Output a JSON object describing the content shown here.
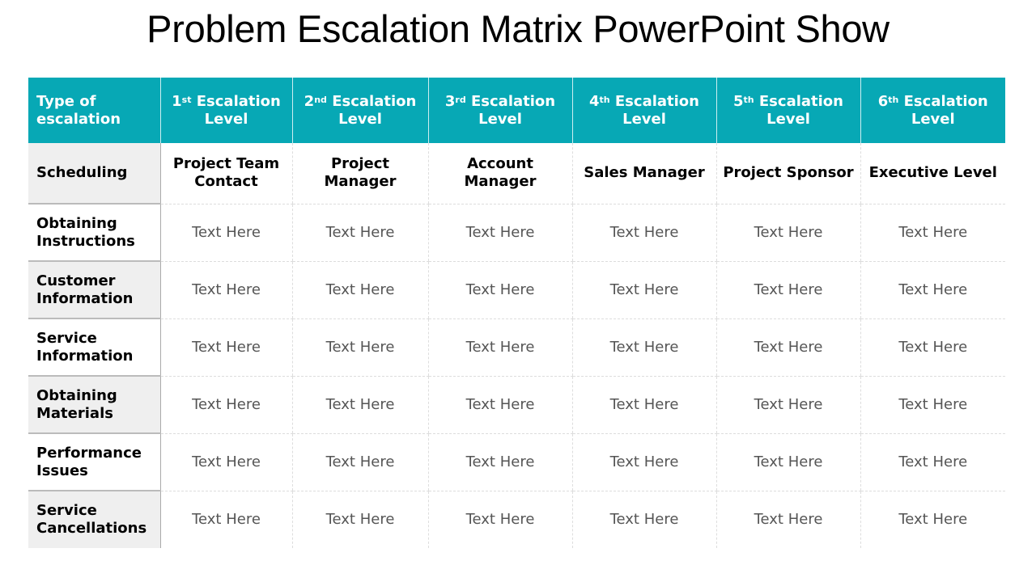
{
  "title": "Problem Escalation Matrix PowerPoint Show",
  "colors": {
    "header_bg": "#07a8b5",
    "header_text": "#ffffff",
    "rowhead_shade": "#efefef",
    "cell_text": "#555555"
  },
  "header": {
    "type_label": "Type of escalation",
    "levels": [
      {
        "num": "1",
        "suffix": "st",
        "label": "Escalation Level"
      },
      {
        "num": "2",
        "suffix": "nd",
        "label": "Escalation Level"
      },
      {
        "num": "3",
        "suffix": "rd",
        "label": "Escalation Level"
      },
      {
        "num": "4",
        "suffix": "th",
        "label": "Escalation Level"
      },
      {
        "num": "5",
        "suffix": "th",
        "label": "Escalation Level"
      },
      {
        "num": "6",
        "suffix": "th",
        "label": "Escalation Level"
      }
    ]
  },
  "rows": [
    {
      "type": "Scheduling",
      "cells": [
        "Project Team Contact",
        "Project Manager",
        "Account Manager",
        "Sales Manager",
        "Project Sponsor",
        "Executive Level"
      ]
    },
    {
      "type": "Obtaining Instructions",
      "cells": [
        "Text Here",
        "Text Here",
        "Text Here",
        "Text Here",
        "Text Here",
        "Text Here"
      ]
    },
    {
      "type": "Customer Information",
      "cells": [
        "Text Here",
        "Text Here",
        "Text Here",
        "Text Here",
        "Text Here",
        "Text Here"
      ]
    },
    {
      "type": "Service Information",
      "cells": [
        "Text Here",
        "Text Here",
        "Text Here",
        "Text Here",
        "Text Here",
        "Text Here"
      ]
    },
    {
      "type": "Obtaining Materials",
      "cells": [
        "Text Here",
        "Text Here",
        "Text Here",
        "Text Here",
        "Text Here",
        "Text Here"
      ]
    },
    {
      "type": "Performance Issues",
      "cells": [
        "Text Here",
        "Text Here",
        "Text Here",
        "Text Here",
        "Text Here",
        "Text Here"
      ]
    },
    {
      "type": "Service Cancellations",
      "cells": [
        "Text Here",
        "Text Here",
        "Text Here",
        "Text Here",
        "Text Here",
        "Text Here"
      ]
    }
  ]
}
